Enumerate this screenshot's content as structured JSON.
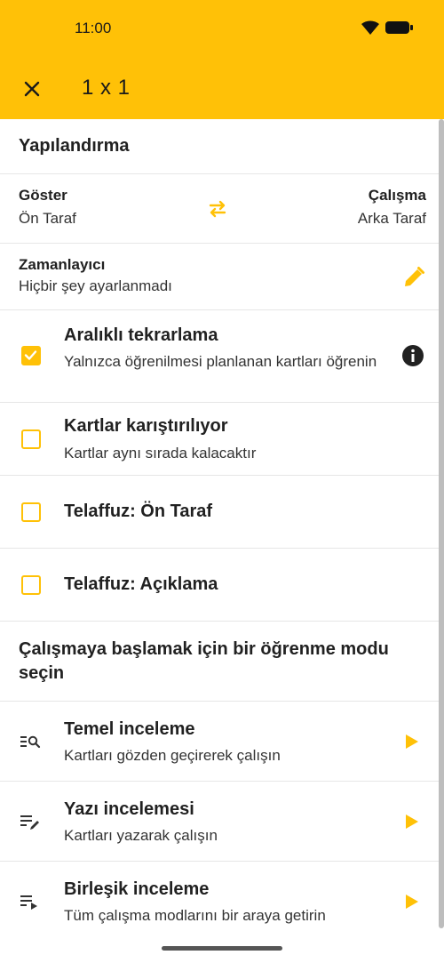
{
  "status_bar": {
    "time": "11:00"
  },
  "app_bar": {
    "title": "1 x 1",
    "color": "#FFC107"
  },
  "configuration": {
    "heading": "Yapılandırma",
    "show_label": "Göster",
    "show_value": "Ön Taraf",
    "study_label": "Çalışma",
    "study_value": "Arka Taraf",
    "timer_label": "Zamanlayıcı",
    "timer_value": "Hiçbir şey ayarlanmadı"
  },
  "options": [
    {
      "title": "Aralıklı tekrarlama",
      "subtitle": "Yalnızca öğrenilmesi planlanan kartları öğrenin",
      "checked": true
    },
    {
      "title": "Kartlar karıştırılıyor",
      "subtitle": "Kartlar aynı sırada kalacaktır",
      "checked": false
    },
    {
      "title": "Telaffuz: Ön Taraf",
      "subtitle": "",
      "checked": false
    },
    {
      "title": "Telaffuz: Açıklama",
      "subtitle": "",
      "checked": false
    }
  ],
  "modes_heading": "Çalışmaya başlamak için bir öğrenme modu seçin",
  "modes": [
    {
      "title": "Temel inceleme",
      "subtitle": "Kartları gözden geçirerek çalışın",
      "icon": "list-search-icon"
    },
    {
      "title": "Yazı incelemesi",
      "subtitle": "Kartları yazarak çalışın",
      "icon": "list-edit-icon"
    },
    {
      "title": "Birleşik inceleme",
      "subtitle": "Tüm çalışma modlarını bir araya getirin",
      "icon": "list-play-icon"
    }
  ]
}
